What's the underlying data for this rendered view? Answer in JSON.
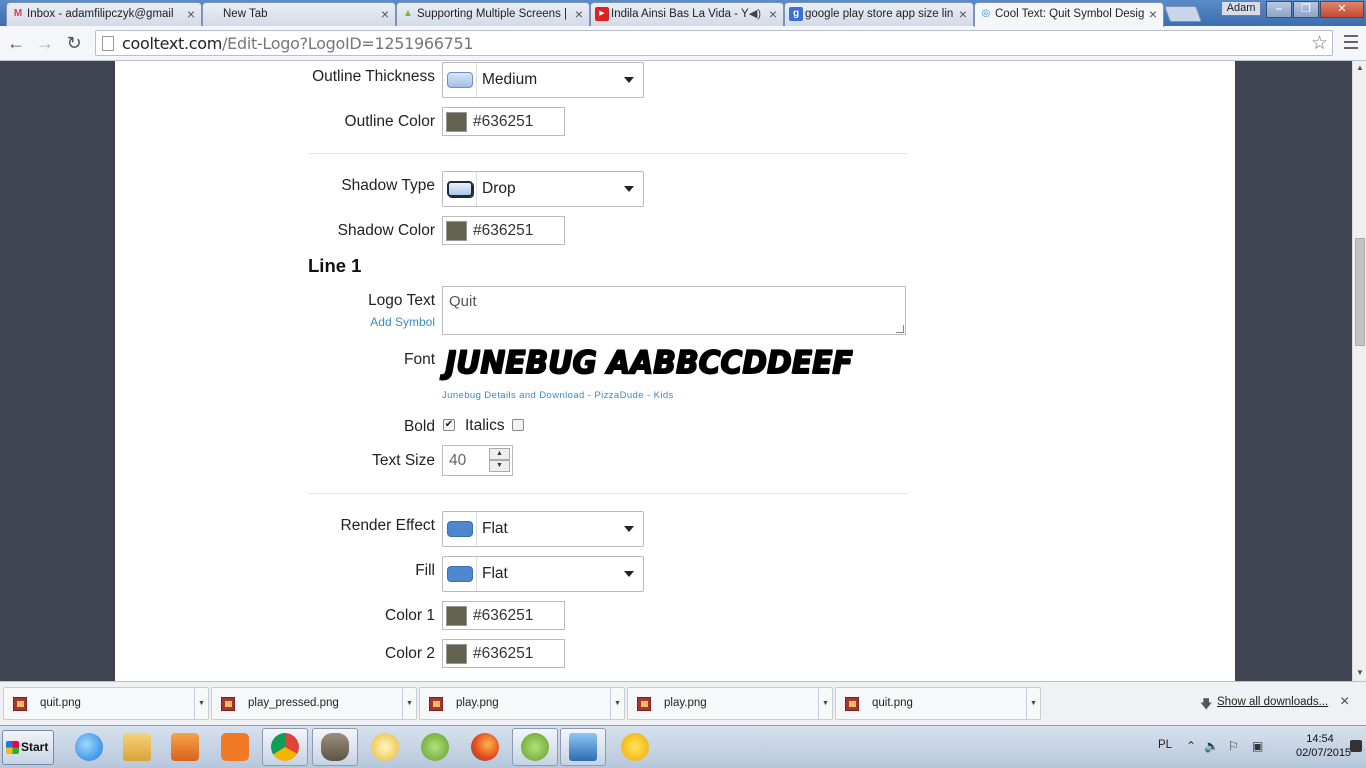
{
  "browser": {
    "tabs": [
      {
        "label": "Inbox - adamfilipczyk@gmail",
        "icon": "gmail-icon"
      },
      {
        "label": "New Tab",
        "icon": "none"
      },
      {
        "label": "Supporting Multiple Screens |",
        "icon": "android-icon"
      },
      {
        "label": "Indila Ainsi Bas La Vida - Y",
        "icon": "youtube-icon"
      },
      {
        "label": "google play store app size lin",
        "icon": "google-icon"
      },
      {
        "label": "Cool Text: Quit Symbol Desig",
        "icon": "cooltext-icon"
      }
    ],
    "user": "Adam",
    "url_host": "cooltext.com",
    "url_path": "/Edit-Logo?LogoID=1251966751"
  },
  "form": {
    "outline_thickness": {
      "label": "Outline Thickness",
      "value": "Medium"
    },
    "outline_color": {
      "label": "Outline Color",
      "value": "#636251"
    },
    "shadow_type": {
      "label": "Shadow Type",
      "value": "Drop"
    },
    "shadow_color": {
      "label": "Shadow Color",
      "value": "#636251"
    },
    "line_heading": "Line 1",
    "logo_text": {
      "label": "Logo Text",
      "value": "Quit",
      "add_symbol": "Add Symbol"
    },
    "font": {
      "label": "Font",
      "preview": "JUNEBUG AABBCCDDEEF",
      "details_link": "Junebug Details and Download",
      "author_link": "PizzaDude",
      "category_link": "Kids",
      "separator": " - "
    },
    "bold": {
      "label": "Bold",
      "checked": true
    },
    "italics": {
      "label": "Italics",
      "checked": false
    },
    "text_size": {
      "label": "Text Size",
      "value": "40"
    },
    "render_effect": {
      "label": "Render Effect",
      "value": "Flat"
    },
    "fill": {
      "label": "Fill",
      "value": "Flat"
    },
    "color1": {
      "label": "Color 1",
      "value": "#636251"
    },
    "color2": {
      "label": "Color 2",
      "value": "#636251"
    }
  },
  "downloads": {
    "items": [
      "quit.png",
      "play_pressed.png",
      "play.png",
      "play.png",
      "quit.png"
    ],
    "show_all": "Show all downloads..."
  },
  "taskbar": {
    "start": "Start",
    "language": "PL",
    "time": "14:54",
    "date": "02/07/2015"
  },
  "colors": {
    "swatch": "#636251",
    "accent_blue": "#4f87cf",
    "link": "#3b8bc4"
  }
}
